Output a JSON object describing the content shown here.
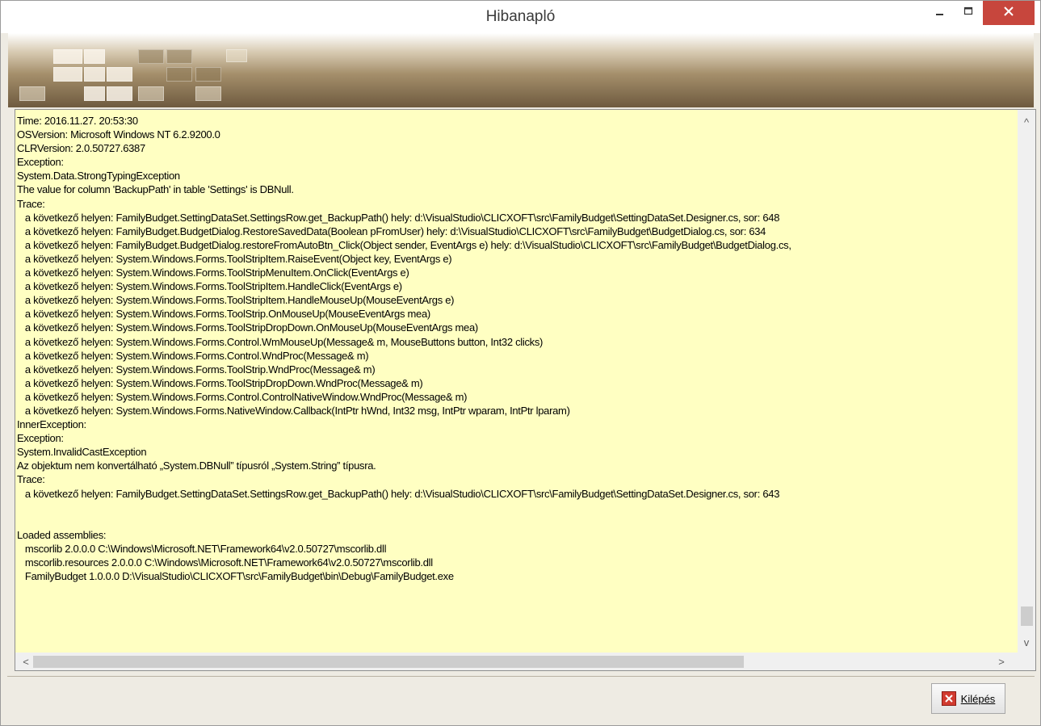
{
  "window": {
    "title": "Hibanapló"
  },
  "titlebar_buttons": {
    "minimize_icon": "minimize-icon",
    "maximize_icon": "maximize-icon",
    "close_icon": "close-icon"
  },
  "log": {
    "lines": [
      "Time: 2016.11.27. 20:53:30",
      "OSVersion: Microsoft Windows NT 6.2.9200.0",
      "CLRVersion: 2.0.50727.6387",
      "Exception:",
      "System.Data.StrongTypingException",
      "The value for column 'BackupPath' in table 'Settings' is DBNull.",
      "Trace:",
      "   a következő helyen: FamilyBudget.SettingDataSet.SettingsRow.get_BackupPath() hely: d:\\VisualStudio\\CLICXOFT\\src\\FamilyBudget\\SettingDataSet.Designer.cs, sor: 648",
      "   a következő helyen: FamilyBudget.BudgetDialog.RestoreSavedData(Boolean pFromUser) hely: d:\\VisualStudio\\CLICXOFT\\src\\FamilyBudget\\BudgetDialog.cs, sor: 634",
      "   a következő helyen: FamilyBudget.BudgetDialog.restoreFromAutoBtn_Click(Object sender, EventArgs e) hely: d:\\VisualStudio\\CLICXOFT\\src\\FamilyBudget\\BudgetDialog.cs,",
      "   a következő helyen: System.Windows.Forms.ToolStripItem.RaiseEvent(Object key, EventArgs e)",
      "   a következő helyen: System.Windows.Forms.ToolStripMenuItem.OnClick(EventArgs e)",
      "   a következő helyen: System.Windows.Forms.ToolStripItem.HandleClick(EventArgs e)",
      "   a következő helyen: System.Windows.Forms.ToolStripItem.HandleMouseUp(MouseEventArgs e)",
      "   a következő helyen: System.Windows.Forms.ToolStrip.OnMouseUp(MouseEventArgs mea)",
      "   a következő helyen: System.Windows.Forms.ToolStripDropDown.OnMouseUp(MouseEventArgs mea)",
      "   a következő helyen: System.Windows.Forms.Control.WmMouseUp(Message& m, MouseButtons button, Int32 clicks)",
      "   a következő helyen: System.Windows.Forms.Control.WndProc(Message& m)",
      "   a következő helyen: System.Windows.Forms.ToolStrip.WndProc(Message& m)",
      "   a következő helyen: System.Windows.Forms.ToolStripDropDown.WndProc(Message& m)",
      "   a következő helyen: System.Windows.Forms.Control.ControlNativeWindow.WndProc(Message& m)",
      "   a következő helyen: System.Windows.Forms.NativeWindow.Callback(IntPtr hWnd, Int32 msg, IntPtr wparam, IntPtr lparam)",
      "InnerException:",
      "Exception:",
      "System.InvalidCastException",
      "Az objektum nem konvertálható „System.DBNull” típusról „System.String” típusra.",
      "Trace:",
      "   a következő helyen: FamilyBudget.SettingDataSet.SettingsRow.get_BackupPath() hely: d:\\VisualStudio\\CLICXOFT\\src\\FamilyBudget\\SettingDataSet.Designer.cs, sor: 643",
      "",
      "",
      "Loaded assemblies:",
      "   mscorlib 2.0.0.0 C:\\Windows\\Microsoft.NET\\Framework64\\v2.0.50727\\mscorlib.dll",
      "   mscorlib.resources 2.0.0.0 C:\\Windows\\Microsoft.NET\\Framework64\\v2.0.50727\\mscorlib.dll",
      "   FamilyBudget 1.0.0.0 D:\\VisualStudio\\CLICXOFT\\src\\FamilyBudget\\bin\\Debug\\FamilyBudget.exe"
    ],
    "background_color": "#ffffc2"
  },
  "scrollbars": {
    "up_arrow": "^",
    "down_arrow": "v",
    "left_arrow": "<",
    "right_arrow": ">"
  },
  "footer": {
    "exit_button_label": "Kilépés",
    "exit_icon": "exit-x-icon"
  },
  "colors": {
    "close_button": "#c7463d",
    "exit_icon": "#d13b30"
  }
}
